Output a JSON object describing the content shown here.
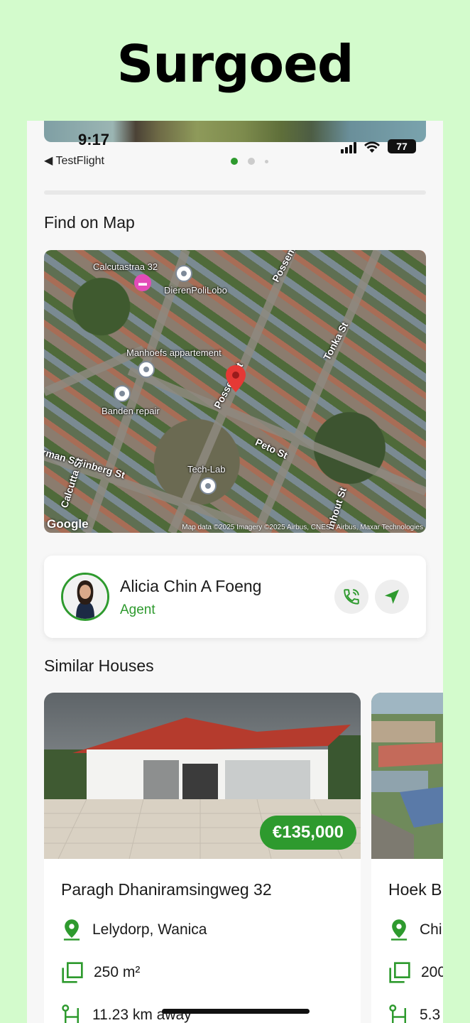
{
  "brand": "Surgoed",
  "status_bar": {
    "time": "9:17",
    "back_app": "◀ TestFlight",
    "battery": "77"
  },
  "map_section": {
    "title": "Find on Map",
    "labels": [
      "Calcutastraa 32",
      "DierenPoliLobo",
      "Manhoefs appartement",
      "Banden repair",
      "Tech-Lab"
    ],
    "streets": [
      "Possentrie St",
      "Tonka St",
      "Posse  e St",
      "Peto St",
      "rman Steinberg St",
      "Calcutta St",
      "inhout St"
    ],
    "google": "Google",
    "attribution": "Map data ©2025 Imagery ©2025 Airbus, CNES / Airbus, Maxar Technologies"
  },
  "agent": {
    "name": "Alicia Chin A Foeng",
    "role": "Agent"
  },
  "similar_section": {
    "title": "Similar Houses",
    "houses": [
      {
        "price": "€135,000",
        "name": "Paragh Dhaniramsingweg 32",
        "location": "Lelydorp, Wanica",
        "area": "250 m²",
        "distance": "11.23 km away"
      },
      {
        "name": "Hoek B",
        "location": "Chi",
        "area": "200",
        "distance": "5.3"
      }
    ]
  },
  "colors": {
    "accent": "#2e9a2e",
    "background": "#d3fbcc",
    "card": "#ffffff"
  }
}
